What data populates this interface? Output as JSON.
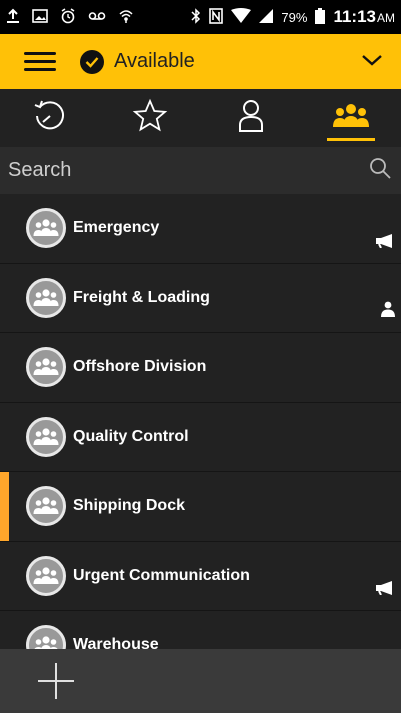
{
  "status_bar": {
    "battery": "79%",
    "time": "11:13",
    "ampm": "AM"
  },
  "header": {
    "availability": "Available"
  },
  "search": {
    "placeholder": "Search"
  },
  "groups": [
    {
      "label": "Emergency",
      "indicator": "megaphone-icon"
    },
    {
      "label": "Freight & Loading",
      "indicator": "person-icon"
    },
    {
      "label": "Offshore Division",
      "indicator": ""
    },
    {
      "label": "Quality Control",
      "indicator": ""
    },
    {
      "label": "Shipping Dock",
      "indicator": "",
      "selected": true
    },
    {
      "label": "Urgent Communication",
      "indicator": "megaphone-icon"
    },
    {
      "label": "Warehouse",
      "indicator": ""
    }
  ],
  "colors": {
    "accent": "#FFC107",
    "selection": "#FFA62B",
    "background": "#222222"
  }
}
